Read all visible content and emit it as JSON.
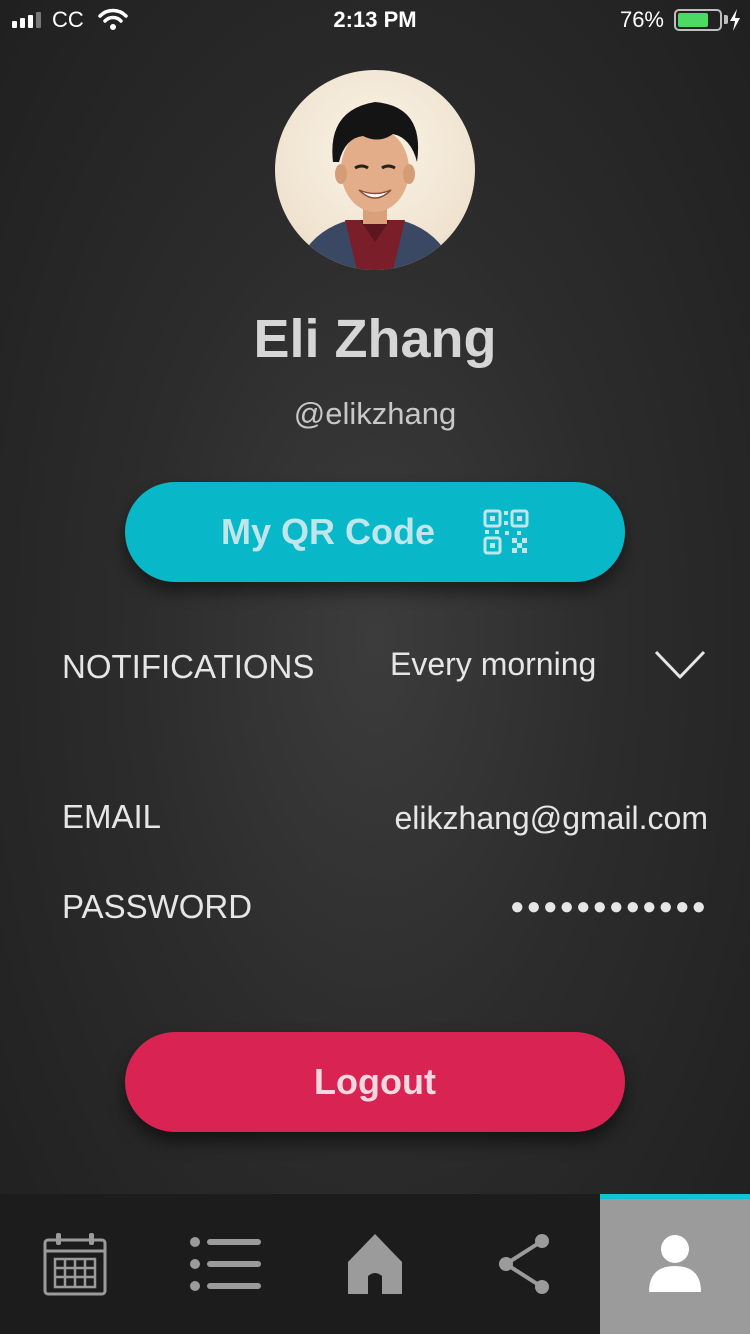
{
  "status_bar": {
    "carrier": "CC",
    "time": "2:13 PM",
    "battery_percent": "76%",
    "battery_level": 0.76,
    "icons": [
      "signal-icon",
      "wifi-icon",
      "battery-icon",
      "charging-bolt-icon"
    ]
  },
  "profile": {
    "name": "Eli Zhang",
    "handle": "@elikzhang"
  },
  "qr_button": {
    "label": "My QR Code",
    "icon": "qr-code-icon"
  },
  "settings": {
    "notifications": {
      "label": "NOTIFICATIONS",
      "value": "Every morning",
      "icon": "chevron-down-icon"
    },
    "email": {
      "label": "EMAIL",
      "value": "elikzhang@gmail.com"
    },
    "password": {
      "label": "PASSWORD",
      "value": "●●●●●●●●●●●●"
    }
  },
  "logout_button": {
    "label": "Logout"
  },
  "tab_bar": {
    "tabs": [
      {
        "name": "calendar",
        "icon": "calendar-icon",
        "active": false
      },
      {
        "name": "list",
        "icon": "list-icon",
        "active": false
      },
      {
        "name": "home",
        "icon": "home-icon",
        "active": false
      },
      {
        "name": "share",
        "icon": "share-icon",
        "active": false
      },
      {
        "name": "profile",
        "icon": "user-icon",
        "active": true
      }
    ]
  },
  "colors": {
    "accent": "#08b8c9",
    "logout": "#d92453",
    "active_tab": "#9b9b9b",
    "active_tab_indicator": "#11c3d3"
  }
}
